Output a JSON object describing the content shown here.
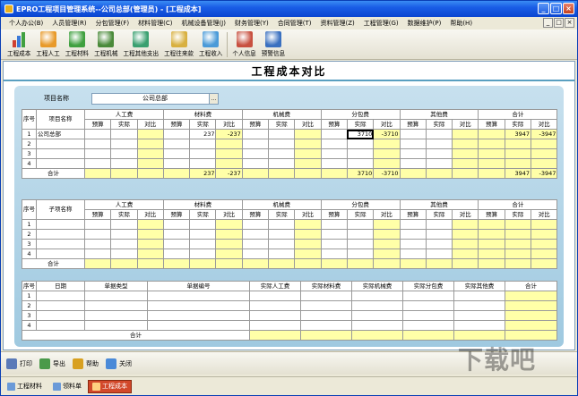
{
  "window": {
    "title": "EPRO工程项目管理系统--公司总部(管理员) - [工程成本]",
    "controls": {
      "minimize": "_",
      "maximize": "□",
      "close": "×"
    }
  },
  "menu": [
    "个人办公(B)",
    "人员管理(R)",
    "分包管理(F)",
    "材料管理(C)",
    "机械设备管理(J)",
    "财务管理(Y)",
    "合同管理(T)",
    "资料管理(Z)",
    "工程管理(G)",
    "数据维护(P)",
    "帮助(H)"
  ],
  "toolbar": [
    {
      "label": "工程成本",
      "icon": "cost-chart-icon"
    },
    {
      "label": "工程人工",
      "icon": "worker-icon"
    },
    {
      "label": "工程材料",
      "icon": "materials-icon"
    },
    {
      "label": "工程机械",
      "icon": "machinery-icon"
    },
    {
      "label": "工程其他支出",
      "icon": "other-expense-icon"
    },
    {
      "label": "工程往来款",
      "icon": "payment-icon"
    },
    {
      "label": "工程收入",
      "icon": "income-icon"
    },
    {
      "label": "个人信息",
      "icon": "person-icon"
    },
    {
      "label": "预警信息",
      "icon": "warning-shield-icon"
    }
  ],
  "page_title": "工程成本对比",
  "project": {
    "label": "项目名称",
    "value": "公司总部"
  },
  "table1": {
    "seq_header": "序号",
    "name_header": "项目名称",
    "groups": [
      "人工费",
      "材料费",
      "机械费",
      "分包费",
      "其他费",
      "合计"
    ],
    "sub": [
      "预算",
      "实际",
      "对比"
    ],
    "rows": [
      {
        "seq": "1",
        "name": "公司总部",
        "cells": [
          "",
          "",
          "",
          "",
          "237",
          "-237",
          "",
          "",
          "",
          "",
          "3710",
          "-3710",
          "",
          "",
          "",
          "",
          "3947",
          "-3947"
        ]
      },
      {
        "seq": "2",
        "name": "",
        "cells": [
          "",
          "",
          "",
          "",
          "",
          "",
          "",
          "",
          "",
          "",
          "",
          "",
          "",
          "",
          "",
          "",
          "",
          ""
        ]
      },
      {
        "seq": "3",
        "name": "",
        "cells": [
          "",
          "",
          "",
          "",
          "",
          "",
          "",
          "",
          "",
          "",
          "",
          "",
          "",
          "",
          "",
          "",
          "",
          ""
        ]
      },
      {
        "seq": "4",
        "name": "",
        "cells": [
          "",
          "",
          "",
          "",
          "",
          "",
          "",
          "",
          "",
          "",
          "",
          "",
          "",
          "",
          "",
          "",
          "",
          ""
        ]
      }
    ],
    "total": {
      "label": "合计",
      "cells": [
        "",
        "",
        "",
        "",
        "237",
        "-237",
        "",
        "",
        "",
        "",
        "3710",
        "-3710",
        "",
        "",
        "",
        "",
        "3947",
        "-3947"
      ]
    }
  },
  "table2": {
    "seq_header": "序号",
    "name_header": "子项名称",
    "groups": [
      "人工费",
      "材料费",
      "机械费",
      "分包费",
      "其他费",
      "合计"
    ],
    "sub": [
      "预算",
      "实际",
      "对比"
    ],
    "rows": [
      "1",
      "2",
      "3",
      "4"
    ],
    "total_label": "合计"
  },
  "table3": {
    "headers": [
      "序号",
      "日期",
      "单据类型",
      "单据编号",
      "实际人工费",
      "实际材料费",
      "实际机械费",
      "实际分包费",
      "实际其他费",
      "合计"
    ],
    "rows": [
      "1",
      "2",
      "3",
      "4"
    ],
    "total_label": "合计"
  },
  "bottom_buttons": [
    {
      "label": "打印",
      "icon": "printer-icon"
    },
    {
      "label": "导出",
      "icon": "export-icon"
    },
    {
      "label": "帮助",
      "icon": "help-icon"
    },
    {
      "label": "关闭",
      "icon": "close-door-icon"
    }
  ],
  "tabs": [
    {
      "label": "工程材料",
      "active": false
    },
    {
      "label": "领料单",
      "active": false
    },
    {
      "label": "工程成本",
      "active": true
    }
  ],
  "watermark": "下载吧"
}
